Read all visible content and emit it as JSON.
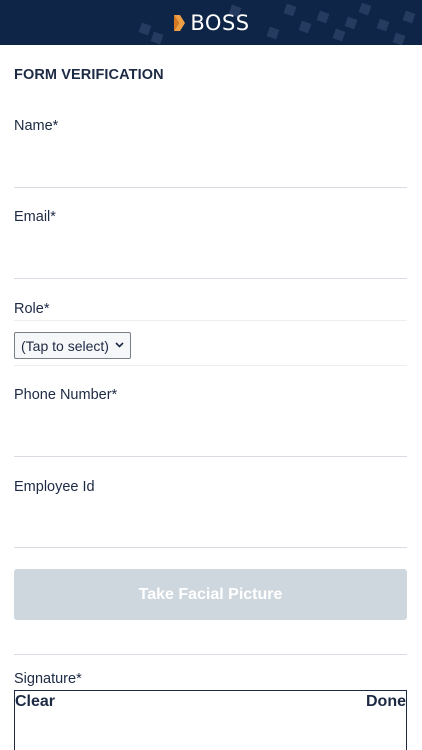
{
  "header": {
    "logo_text": "BOSS",
    "background": "#0f2547"
  },
  "form": {
    "title": "FORM VERIFICATION",
    "fields": {
      "name": {
        "label": "Name*",
        "value": ""
      },
      "email": {
        "label": "Email*",
        "value": ""
      },
      "role": {
        "label": "Role*",
        "selected": "(Tap to select)"
      },
      "phone": {
        "label": "Phone Number*",
        "value": ""
      },
      "employee_id": {
        "label": "Employee Id",
        "value": ""
      }
    },
    "facial_button": "Take Facial Picture",
    "signature": {
      "label": "Signature*",
      "clear": "Clear",
      "done": "Done"
    }
  },
  "icons": {
    "logo": "boss-logo-icon",
    "chevron": "chevron-down-icon"
  },
  "colors": {
    "text": "#1d2a44",
    "button_disabled": "#cfd7de"
  }
}
